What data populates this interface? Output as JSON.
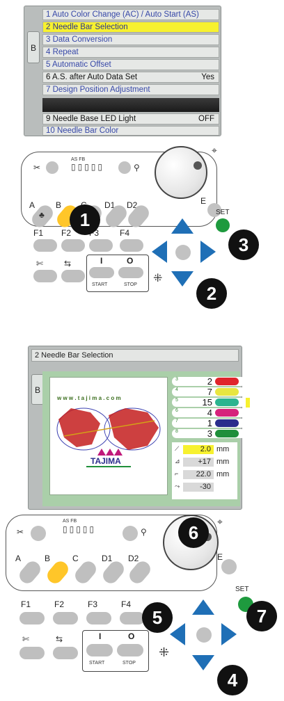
{
  "tab_label": "B",
  "menu": {
    "items": [
      {
        "label": "1 Auto Color Change (AC) / Auto Start (AS)",
        "value": ""
      },
      {
        "label": "2 Needle Bar Selection",
        "value": ""
      },
      {
        "label": "3 Data Conversion",
        "value": ""
      },
      {
        "label": "4 Repeat",
        "value": ""
      },
      {
        "label": "5 Automatic Offset",
        "value": ""
      },
      {
        "label": "6 A.S. after Auto Data Set",
        "value": "Yes"
      },
      {
        "label": "7 Design Position Adjustment",
        "value": ""
      },
      {
        "label": "9 Needle Base LED Light",
        "value": "OFF"
      },
      {
        "label": "10 Needle Bar Color",
        "value": ""
      }
    ]
  },
  "panel": {
    "status_labels": "AS FB",
    "buttons": {
      "a": "A",
      "b": "B",
      "c": "C",
      "d1": "D1",
      "d2": "D2",
      "e": "E",
      "f1": "F1",
      "f2": "F2",
      "f3": "F3",
      "f4": "F4"
    },
    "start_label": "START",
    "stop_label": "STOP",
    "start_symbol": "I",
    "stop_symbol": "O",
    "set_label": "SET"
  },
  "steps": {
    "s1": "1",
    "s2": "2",
    "s3": "3",
    "s4": "4",
    "s5": "5",
    "s6": "6",
    "s7": "7"
  },
  "screen2": {
    "title": "2 Needle Bar Selection",
    "logo_text": "w w w . t a j i m a . c o m",
    "brand": "TAJIMA",
    "needle_bars": [
      {
        "num": "3",
        "value": "2",
        "color": "#e0252b"
      },
      {
        "num": "4",
        "value": "7",
        "color": "#e8e640"
      },
      {
        "num": "5",
        "value": "15",
        "color": "#2bb48f"
      },
      {
        "num": "6",
        "value": "4",
        "color": "#d6237b"
      },
      {
        "num": "7",
        "value": "1",
        "color": "#2a2d8c"
      },
      {
        "num": "8",
        "value": "3",
        "color": "#1f8f3a"
      }
    ],
    "offsets": [
      {
        "value": "2.0",
        "unit": "mm"
      },
      {
        "value": "+17",
        "unit": "mm"
      },
      {
        "value": "22.0",
        "unit": "mm"
      },
      {
        "value": "-30",
        "unit": ""
      }
    ]
  },
  "colors": {
    "accent_blue": "#1f6fb6",
    "set_green": "#1e9a3e",
    "highlight_yellow": "#f7f12f",
    "selected_orange": "#ffc629"
  }
}
